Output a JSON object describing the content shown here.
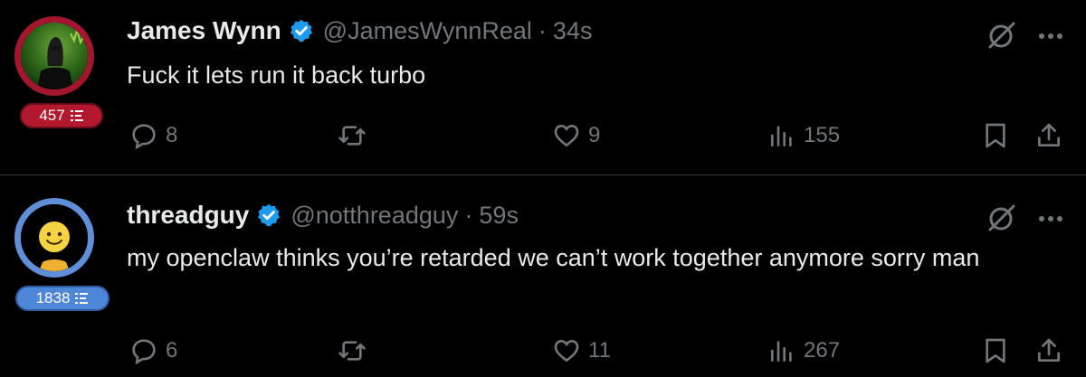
{
  "posts": [
    {
      "name": "James Wynn",
      "handle": "@JamesWynnReal",
      "separator": "·",
      "time": "34s",
      "text": "Fuck it lets run it back turbo",
      "badge": "457",
      "badge_color": "#b3182f",
      "ring_color": "#a3162d",
      "stats": {
        "replies": "8",
        "reposts": "",
        "likes": "9",
        "views": "155"
      }
    },
    {
      "name": "threadguy",
      "handle": "@notthreadguy",
      "separator": "·",
      "time": "59s",
      "text": "my openclaw thinks you’re retarded we can’t work together anymore sorry man",
      "badge": "1838",
      "badge_color": "#4e86d8",
      "ring_color": "#5e8fd8",
      "stats": {
        "replies": "6",
        "reposts": "",
        "likes": "11",
        "views": "267"
      }
    }
  ],
  "colors": {
    "background": "#000000",
    "text": "#e7e9ea",
    "muted": "#71767b",
    "verified": "#1d9bf0"
  },
  "icons": [
    "verified-badge-icon",
    "grok-icon",
    "more-icon",
    "reply-icon",
    "repost-icon",
    "like-icon",
    "views-icon",
    "bookmark-icon",
    "share-icon",
    "leaderboard-icon"
  ]
}
